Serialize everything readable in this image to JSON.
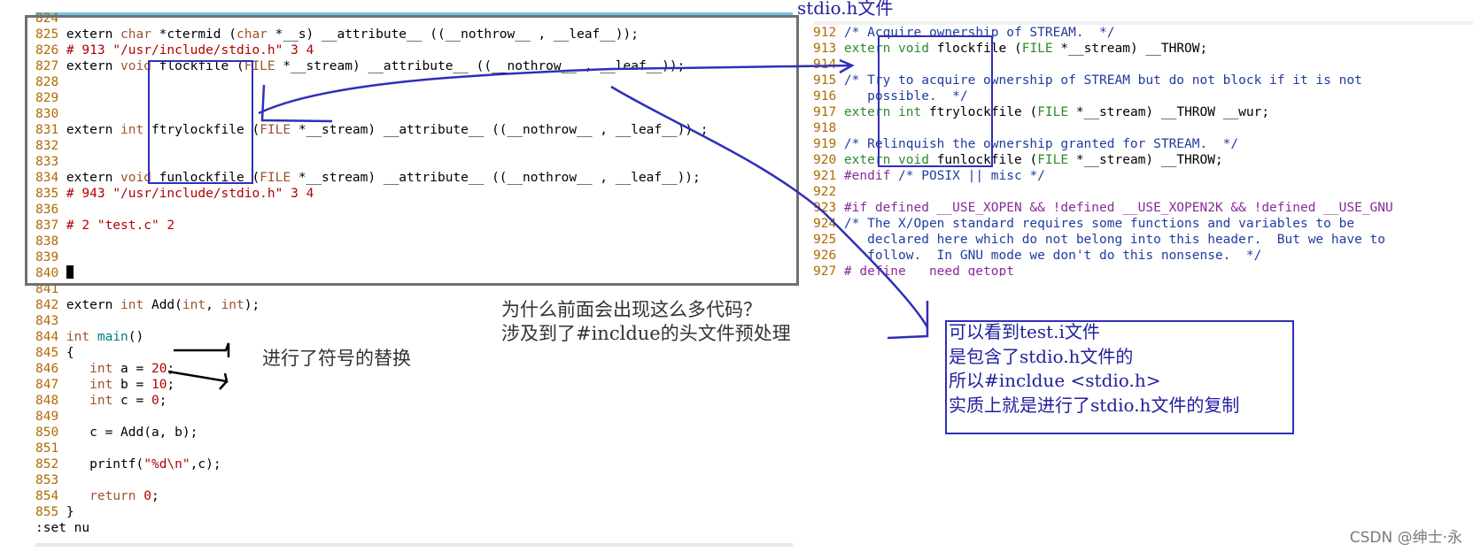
{
  "left_editor": {
    "lines": [
      {
        "n": "824",
        "parts": []
      },
      {
        "n": "825",
        "parts": [
          [
            "t",
            "extern "
          ],
          [
            "kw",
            "char"
          ],
          [
            "t",
            " *ctermid ("
          ],
          [
            "kw",
            "char"
          ],
          [
            "t",
            " *__s) __attribute__ ((__nothrow__ , __leaf__));"
          ]
        ]
      },
      {
        "n": "826",
        "parts": [
          [
            "pp",
            "# 913 "
          ],
          [
            "str",
            "\"/usr/include/stdio.h\""
          ],
          [
            "pp",
            " 3 4"
          ]
        ]
      },
      {
        "n": "827",
        "parts": [
          [
            "t",
            "extern "
          ],
          [
            "kw",
            "void"
          ],
          [
            "t",
            " flockfile ("
          ],
          [
            "kw",
            "FILE"
          ],
          [
            "t",
            " *__stream) __attribute__ ((__nothrow__ , __leaf__));"
          ]
        ]
      },
      {
        "n": "828",
        "parts": []
      },
      {
        "n": "829",
        "parts": []
      },
      {
        "n": "830",
        "parts": []
      },
      {
        "n": "831",
        "parts": [
          [
            "t",
            "extern "
          ],
          [
            "kw",
            "int"
          ],
          [
            "t",
            " ftrylockfile ("
          ],
          [
            "kw",
            "FILE"
          ],
          [
            "t",
            " *__stream) __attribute__ ((__nothrow__ , __leaf__)) ;"
          ]
        ]
      },
      {
        "n": "832",
        "parts": []
      },
      {
        "n": "833",
        "parts": []
      },
      {
        "n": "834",
        "parts": [
          [
            "t",
            "extern "
          ],
          [
            "kw",
            "void"
          ],
          [
            "t",
            " funlockfile ("
          ],
          [
            "kw",
            "FILE"
          ],
          [
            "t",
            " *__stream) __attribute__ ((__nothrow__ , __leaf__));"
          ]
        ]
      },
      {
        "n": "835",
        "parts": [
          [
            "pp",
            "# 943 "
          ],
          [
            "str",
            "\"/usr/include/stdio.h\""
          ],
          [
            "pp",
            " 3 4"
          ]
        ]
      },
      {
        "n": "836",
        "parts": []
      },
      {
        "n": "837",
        "parts": [
          [
            "pp",
            "# 2 "
          ],
          [
            "str",
            "\"test.c\""
          ],
          [
            "pp",
            " 2"
          ]
        ]
      },
      {
        "n": "838",
        "parts": []
      },
      {
        "n": "839",
        "parts": []
      },
      {
        "n": "840",
        "parts": [
          [
            "cursor",
            ""
          ]
        ]
      },
      {
        "n": "841",
        "parts": []
      },
      {
        "n": "842",
        "parts": [
          [
            "t",
            "extern "
          ],
          [
            "kw",
            "int"
          ],
          [
            "t",
            " Add("
          ],
          [
            "kw",
            "int"
          ],
          [
            "t",
            ", "
          ],
          [
            "kw",
            "int"
          ],
          [
            "t",
            ");"
          ]
        ]
      },
      {
        "n": "843",
        "parts": []
      },
      {
        "n": "844",
        "parts": [
          [
            "kw",
            "int"
          ],
          [
            "t",
            " "
          ],
          [
            "fn",
            "main"
          ],
          [
            "t",
            "()"
          ]
        ]
      },
      {
        "n": "845",
        "parts": [
          [
            "t",
            "{"
          ]
        ]
      },
      {
        "n": "846",
        "parts": [
          [
            "t",
            "   "
          ],
          [
            "kw",
            "int"
          ],
          [
            "t",
            " a = "
          ],
          [
            "str",
            "20"
          ],
          [
            "t",
            ";"
          ]
        ]
      },
      {
        "n": "847",
        "parts": [
          [
            "t",
            "   "
          ],
          [
            "kw",
            "int"
          ],
          [
            "t",
            " b = "
          ],
          [
            "str",
            "10"
          ],
          [
            "t",
            ";"
          ]
        ]
      },
      {
        "n": "848",
        "parts": [
          [
            "t",
            "   "
          ],
          [
            "kw",
            "int"
          ],
          [
            "t",
            " c = "
          ],
          [
            "str",
            "0"
          ],
          [
            "t",
            ";"
          ]
        ]
      },
      {
        "n": "849",
        "parts": []
      },
      {
        "n": "850",
        "parts": [
          [
            "t",
            "   c = Add(a, b);"
          ]
        ]
      },
      {
        "n": "851",
        "parts": []
      },
      {
        "n": "852",
        "parts": [
          [
            "t",
            "   printf("
          ],
          [
            "str",
            "\"%d\\n\""
          ],
          [
            "t",
            ",c);"
          ]
        ]
      },
      {
        "n": "853",
        "parts": []
      },
      {
        "n": "854",
        "parts": [
          [
            "t",
            "   "
          ],
          [
            "kw",
            "return"
          ],
          [
            "t",
            " "
          ],
          [
            "str",
            "0"
          ],
          [
            "t",
            ";"
          ]
        ]
      },
      {
        "n": "855",
        "parts": [
          [
            "t",
            "}"
          ]
        ]
      }
    ],
    "command": ":set nu"
  },
  "right_editor": {
    "title": "stdio.h文件",
    "lines": [
      {
        "n": "912",
        "parts": [
          [
            "cm",
            "/* Acquire ownership of STREAM.  */"
          ]
        ]
      },
      {
        "n": "913",
        "parts": [
          [
            "rkw",
            "extern"
          ],
          [
            "t",
            " "
          ],
          [
            "rkw",
            "void"
          ],
          [
            "t",
            " flockfile ("
          ],
          [
            "rkw",
            "FILE"
          ],
          [
            "t",
            " *__stream) __THROW;"
          ]
        ]
      },
      {
        "n": "914",
        "parts": []
      },
      {
        "n": "915",
        "parts": [
          [
            "cm",
            "/* Try to acquire ownership of STREAM but do not block if it is not"
          ]
        ]
      },
      {
        "n": "916",
        "parts": [
          [
            "cm",
            "   possible.  */"
          ]
        ]
      },
      {
        "n": "917",
        "parts": [
          [
            "rkw",
            "extern"
          ],
          [
            "t",
            " "
          ],
          [
            "rkw",
            "int"
          ],
          [
            "t",
            " ftrylockfile ("
          ],
          [
            "rkw",
            "FILE"
          ],
          [
            "t",
            " *__stream) __THROW __wur;"
          ]
        ]
      },
      {
        "n": "918",
        "parts": []
      },
      {
        "n": "919",
        "parts": [
          [
            "cm",
            "/* Relinquish the ownership granted for STREAM.  */"
          ]
        ]
      },
      {
        "n": "920",
        "parts": [
          [
            "rkw",
            "extern"
          ],
          [
            "t",
            " "
          ],
          [
            "rkw",
            "void"
          ],
          [
            "t",
            " funlockfile ("
          ],
          [
            "rkw",
            "FILE"
          ],
          [
            "t",
            " *__stream) __THROW;"
          ]
        ]
      },
      {
        "n": "921",
        "parts": [
          [
            "rpp",
            "#endif"
          ],
          [
            "t",
            " "
          ],
          [
            "cm",
            "/* POSIX || misc */"
          ]
        ]
      },
      {
        "n": "922",
        "parts": []
      },
      {
        "n": "923",
        "parts": [
          [
            "rpp",
            "#if defined __USE_XOPEN && !defined __USE_XOPEN2K && !defined __USE_GNU"
          ]
        ]
      },
      {
        "n": "924",
        "parts": [
          [
            "cm",
            "/* The X/Open standard requires some functions and variables to be"
          ]
        ]
      },
      {
        "n": "925",
        "parts": [
          [
            "cm",
            "   declared here which do not belong into this header.  But we have to"
          ]
        ]
      },
      {
        "n": "926",
        "parts": [
          [
            "cm",
            "   follow.  In GNU mode we don't do this nonsense.  */"
          ]
        ]
      },
      {
        "n": "927",
        "parts": [
          [
            "rpp",
            "# define __need_getopt"
          ]
        ]
      }
    ]
  },
  "notes": {
    "question": "为什么前面会出现这么多代码？\n涉及到了#incldue的头文件预处理",
    "replacement": "进行了符号的替换",
    "explanation": "可以看到test.i文件\n是包含了stdio.h文件的\n所以#incldue <stdio.h>\n实质上就是进行了stdio.h文件的复制"
  },
  "watermark": "CSDN @绅士·永",
  "colors": {
    "annotation": "#2f2fb8",
    "line_number": "#b06a00",
    "comment": "#1f3ca0"
  }
}
